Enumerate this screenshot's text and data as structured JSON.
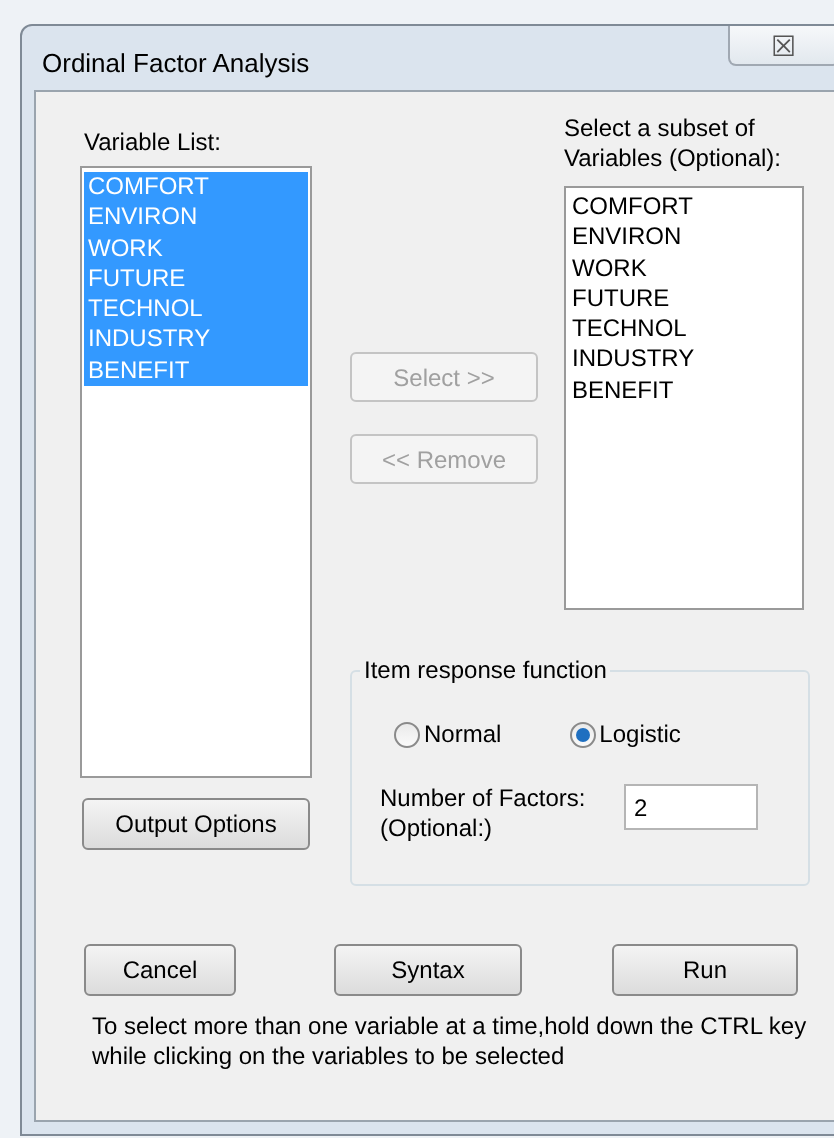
{
  "window": {
    "title": "Ordinal Factor Analysis",
    "close_glyph": "☒"
  },
  "variable_list": {
    "label": "Variable List:",
    "items": [
      {
        "text": "COMFORT",
        "selected": true
      },
      {
        "text": "ENVIRON",
        "selected": true
      },
      {
        "text": "WORK",
        "selected": true
      },
      {
        "text": "FUTURE",
        "selected": true
      },
      {
        "text": "TECHNOL",
        "selected": true
      },
      {
        "text": "INDUSTRY",
        "selected": true
      },
      {
        "text": "BENEFIT",
        "selected": true
      }
    ]
  },
  "move_buttons": [
    {
      "label": "Select >>",
      "disabled": true
    },
    {
      "label": "<< Remove",
      "disabled": true
    }
  ],
  "subset_list": {
    "label": "Select a subset of Variables (Optional):",
    "items": [
      {
        "text": "COMFORT",
        "selected": false
      },
      {
        "text": "ENVIRON",
        "selected": false
      },
      {
        "text": "WORK",
        "selected": false
      },
      {
        "text": "FUTURE",
        "selected": false
      },
      {
        "text": "TECHNOL",
        "selected": false
      },
      {
        "text": "INDUSTRY",
        "selected": false
      },
      {
        "text": "BENEFIT",
        "selected": false
      }
    ]
  },
  "output_options_button": "Output Options",
  "item_response_function": {
    "title": "Item response function",
    "options": [
      {
        "label": "Normal",
        "selected": false
      },
      {
        "label": "Logistic",
        "selected": true
      }
    ],
    "factors_label": "Number of Factors: (Optional:)",
    "factors_value": "2"
  },
  "buttons": [
    "Cancel",
    "Syntax",
    "Run"
  ],
  "hint": "To select more than one variable at a time,hold down the CTRL key while clicking on the variables to be selected"
}
